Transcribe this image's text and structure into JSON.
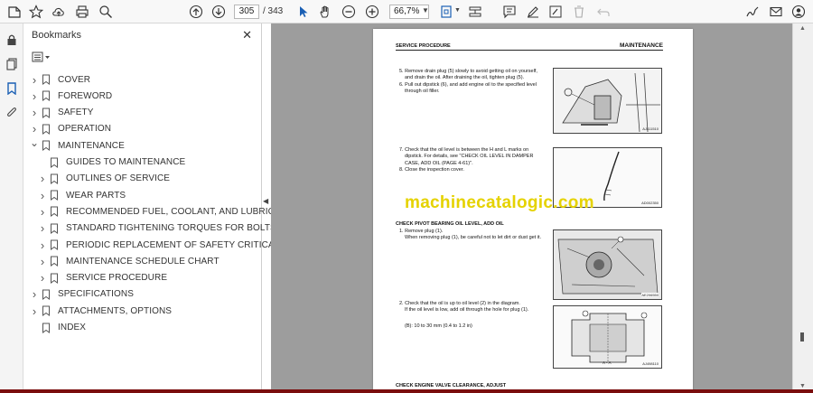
{
  "toolbar": {
    "page_current": "305",
    "page_total": "/ 343",
    "zoom": "66,7%"
  },
  "bookmarks": {
    "title": "Bookmarks",
    "items": [
      {
        "label": "COVER",
        "expandable": true,
        "level": 0,
        "expanded": false
      },
      {
        "label": "FOREWORD",
        "expandable": true,
        "level": 0,
        "expanded": false
      },
      {
        "label": "SAFETY",
        "expandable": true,
        "level": 0,
        "expanded": false
      },
      {
        "label": "OPERATION",
        "expandable": true,
        "level": 0,
        "expanded": false
      },
      {
        "label": "MAINTENANCE",
        "expandable": true,
        "level": 0,
        "expanded": true
      },
      {
        "label": "GUIDES TO MAINTENANCE",
        "expandable": false,
        "level": 1
      },
      {
        "label": "OUTLINES OF SERVICE",
        "expandable": true,
        "level": 1
      },
      {
        "label": "WEAR PARTS",
        "expandable": true,
        "level": 1
      },
      {
        "label": "RECOMMENDED FUEL, COOLANT, AND LUBRICANT",
        "expandable": true,
        "level": 1
      },
      {
        "label": "STANDARD TIGHTENING TORQUES FOR BOLTS AND NUTS",
        "expandable": true,
        "level": 1
      },
      {
        "label": "PERIODIC REPLACEMENT OF SAFETY CRITICAL PARTS",
        "expandable": true,
        "level": 1
      },
      {
        "label": "MAINTENANCE SCHEDULE CHART",
        "expandable": true,
        "level": 1
      },
      {
        "label": "SERVICE PROCEDURE",
        "expandable": true,
        "level": 1
      },
      {
        "label": "SPECIFICATIONS",
        "expandable": true,
        "level": 0
      },
      {
        "label": "ATTACHMENTS, OPTIONS",
        "expandable": true,
        "level": 0
      },
      {
        "label": "INDEX",
        "expandable": false,
        "level": 0
      }
    ]
  },
  "page": {
    "header_left": "SERVICE PROCEDURE",
    "header_right": "MAINTENANCE",
    "step5": "5. Remove drain plug (5) slowly to avoid getting oil on yourself,",
    "step5b": "and drain the oil. After draining the oil, tighten plug (5).",
    "step6": "6. Pull out dipstick (6), and add engine oil to the specified level",
    "step6b": "through oil filler.",
    "step7": "7. Check that the oil level is between the H and L marks on",
    "step7b": "dipstick. For details, see \"CHECK OIL LEVEL IN DAMPER",
    "step7c": "CASE, ADD OIL (PAGE 4-61)\".",
    "step8": "8. Close the inspection cover.",
    "section_pivot": "CHECK PIVOT BEARING OIL LEVEL, ADD OIL",
    "pivot1": "1. Remove plug (1).",
    "pivot1b": "When removing plug (1), be careful not to let dirt or dust get it.",
    "pivot2": "2. Check that the oil is up to oil level (2) in the diagram.",
    "pivot2b": "If the oil level is low, add oil through the hole for plug (1).",
    "pivot_range": "(B): 10 to 30 mm (0.4 to 1.2 in)",
    "section_valve": "CHECK ENGINE VALVE CLEARANCE, ADJUST",
    "fig1_code": "AJ411510",
    "fig2_code": "AD002350",
    "fig3_code": "AE206550",
    "fig4_code": "AJ498110",
    "fig4_label": "A - A",
    "watermark": "machinecatalogic.com"
  },
  "colors": {
    "watermark": "#e5d200",
    "viewer_bg": "#9d9d9d",
    "accent": "#1a5fb4"
  }
}
